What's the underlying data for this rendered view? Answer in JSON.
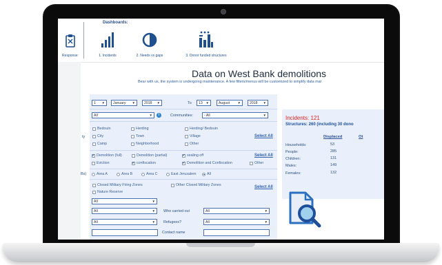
{
  "nav": {
    "dashboards_label": "Dashboards:",
    "items": [
      {
        "label": "Response:"
      },
      {
        "label": "1. Incidents"
      },
      {
        "label": "2. Needs vs gaps"
      },
      {
        "label": "3. Donor funded structures"
      }
    ]
  },
  "page": {
    "title": "Data on West Bank demolitions",
    "subtitle": "Bear with us, the system is undergoing maintenance. A few filters/menus will be customized to simplify data mar"
  },
  "form": {
    "date_from": {
      "day": "1",
      "month": "January",
      "year": "2018"
    },
    "to_label": "To",
    "date_to": {
      "day": "13",
      "month": "August",
      "year": "2018"
    },
    "governorate": "All",
    "communities_label": "Communities:",
    "communities_value": "- All",
    "community_type_side": "ty",
    "community_types": [
      "Bedouin",
      "Herding",
      "Herding/ Bedouin",
      "City",
      "Town",
      "Village",
      "Camp",
      "Neighborhood",
      "Other"
    ],
    "select_all": "Select All",
    "demolition_types": [
      {
        "label": "Demolition (full)",
        "checked": true
      },
      {
        "label": "Demolition (partial)",
        "checked": false
      },
      {
        "label": "sealing off",
        "checked": true
      },
      {
        "label": "Eviction",
        "checked": false
      },
      {
        "label": "confiscation",
        "checked": true
      },
      {
        "label": "Demolition and Confiscation",
        "checked": true
      },
      {
        "label": "Other",
        "checked": false
      }
    ],
    "area_side": "Bs)",
    "areas": [
      {
        "label": "Area A",
        "selected": false
      },
      {
        "label": "Area B",
        "selected": false
      },
      {
        "label": "Area C",
        "selected": false
      },
      {
        "label": "East Jerusalem",
        "selected": false
      },
      {
        "label": "All",
        "selected": true
      }
    ],
    "zones": [
      "Closed Military Firing Zones",
      "Other Closed Military Zones",
      "Nature Reserve"
    ],
    "select_all_3": "Select All",
    "row_all_1": "All",
    "row_all_2": "All",
    "who_carried_out_label": "Who carried out",
    "who_carried_out_value": "All",
    "row_all_3": "All",
    "refugees_label": "Refugees?",
    "refugees_value": "All",
    "contact_name_label": "Contact name"
  },
  "results": {
    "incidents": "Incidents: 121",
    "structures": "Structures: 260 (including 30 dono",
    "col_displaced": "Displaced",
    "col_other": "Ot",
    "rows": [
      {
        "label": "Households:",
        "value": "53"
      },
      {
        "label": "People:",
        "value": "285"
      },
      {
        "label": "Children:",
        "value": "131"
      },
      {
        "label": "Males:",
        "value": "149"
      },
      {
        "label": "Females:",
        "value": "132"
      }
    ]
  },
  "colors": {
    "accent": "#2b5db0",
    "incidents_red": "#e0201e",
    "panel_bg": "#e9f0fb",
    "icon_blue": "#2a6fc0"
  }
}
